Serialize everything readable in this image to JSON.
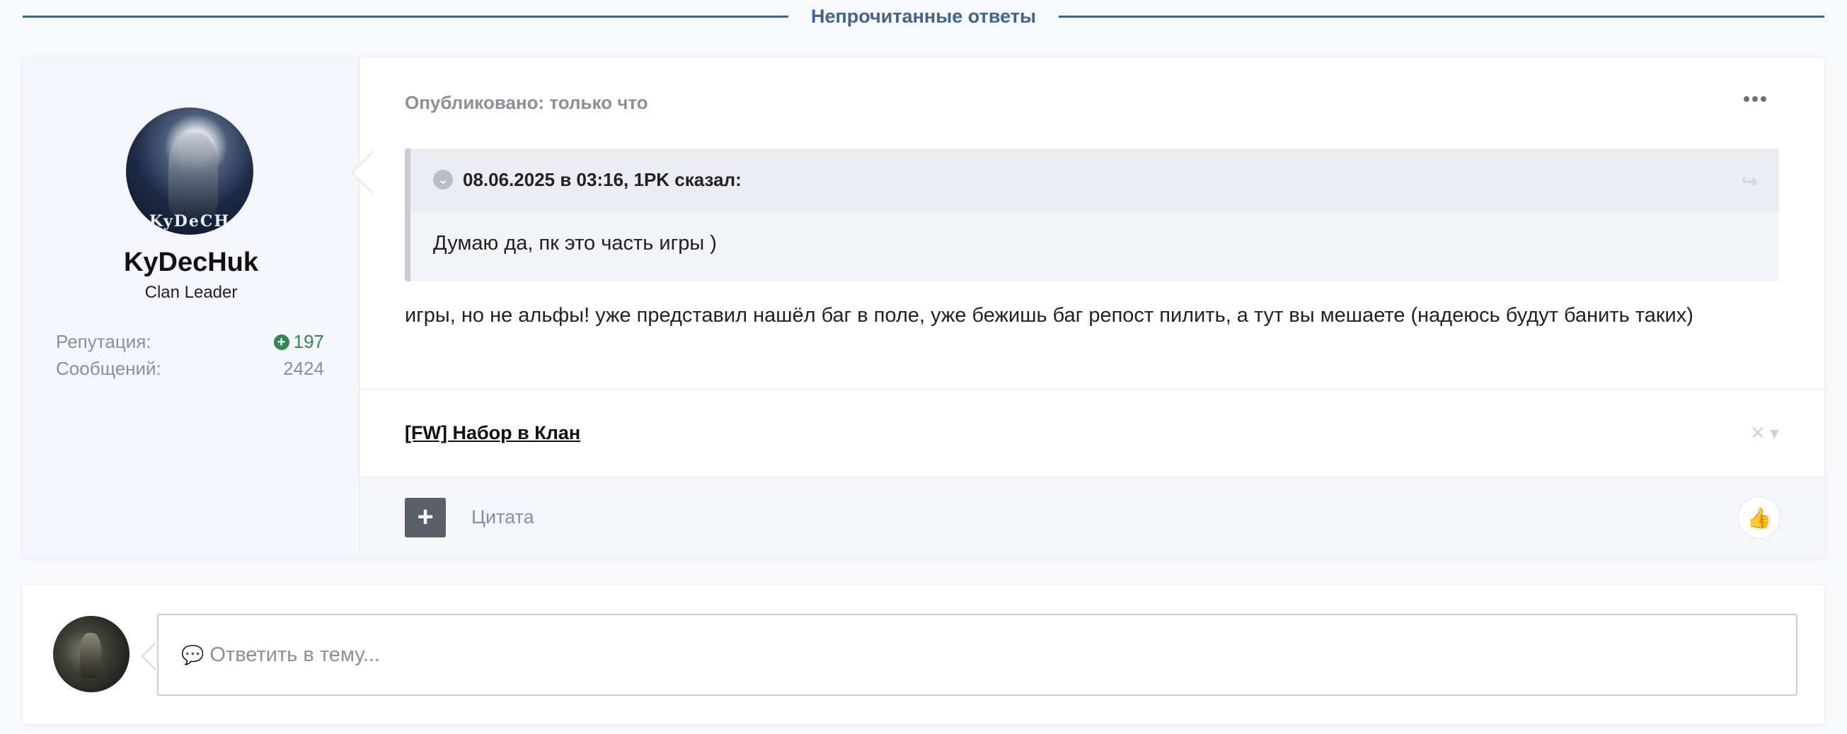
{
  "separator": {
    "label": "Непрочитанные ответы"
  },
  "author": {
    "name": "KyDecHuk",
    "rank": "Clan Leader",
    "avatar_text": "KyDeCH",
    "reputation_label": "Репутация:",
    "reputation_value": "197",
    "messages_label": "Сообщений:",
    "messages_value": "2424"
  },
  "post": {
    "published": "Опубликовано: только что",
    "quote": {
      "header": "08.06.2025 в 03:16, 1PK сказал:",
      "body": "Думаю да, пк это часть игры )"
    },
    "text": "игры, но не альфы! уже представил нашёл баг в поле, уже бежишь баг репост пилить, а тут вы мешаете (надеюсь будут банить таких)",
    "signature_link": "[FW] Набор в Клан",
    "quote_label": "Цитата"
  },
  "reply": {
    "placeholder": "Ответить в тему..."
  },
  "colors": {
    "accent": "#3d6594",
    "reputation": "#2f8a52",
    "button": "#5a5f69"
  },
  "icons": [
    "more-icon",
    "chevron-down-icon",
    "share-icon",
    "close-icon",
    "plus-icon",
    "thumbs-up-icon",
    "comment-icon",
    "plus-circle-icon"
  ]
}
